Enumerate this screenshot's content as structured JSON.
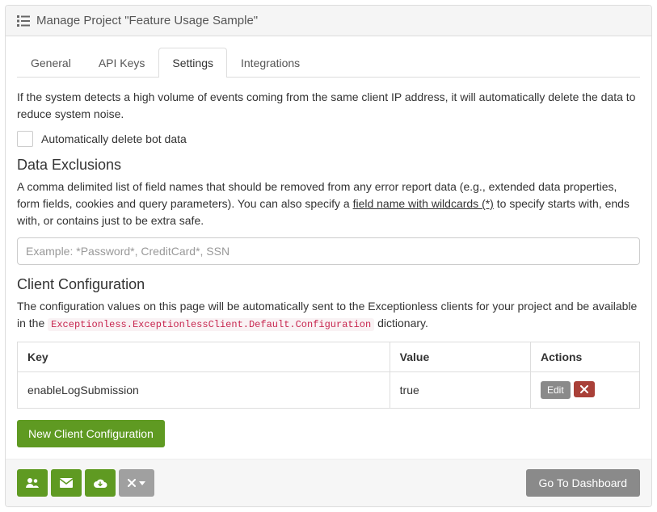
{
  "header": {
    "title": "Manage Project \"Feature Usage Sample\""
  },
  "tabs": {
    "general": "General",
    "api_keys": "API Keys",
    "settings": "Settings",
    "integrations": "Integrations",
    "active": "settings"
  },
  "settings": {
    "bot_help": "If the system detects a high volume of events coming from the same client IP address, it will automatically delete the data to reduce system noise.",
    "bot_checkbox_label": "Automatically delete bot data",
    "exclusions": {
      "title": "Data Exclusions",
      "desc_pre": "A comma delimited list of field names that should be removed from any error report data (e.g., extended data properties, form fields, cookies and query parameters). You can also specify a ",
      "desc_link": "field name with wildcards (*)",
      "desc_post": " to specify starts with, ends with, or contains just to be extra safe.",
      "placeholder": "Example: *Password*, CreditCard*, SSN"
    },
    "client_config": {
      "title": "Client Configuration",
      "desc_pre": "The configuration values on this page will be automatically sent to the Exceptionless clients for your project and be available in the ",
      "code": "Exceptionless.ExceptionlessClient.Default.Configuration",
      "desc_post": " dictionary.",
      "columns": {
        "key": "Key",
        "value": "Value",
        "actions": "Actions"
      },
      "rows": [
        {
          "key": "enableLogSubmission",
          "value": "true"
        }
      ],
      "edit_label": "Edit",
      "new_button": "New Client Configuration"
    }
  },
  "footer": {
    "go_dashboard": "Go To Dashboard"
  }
}
